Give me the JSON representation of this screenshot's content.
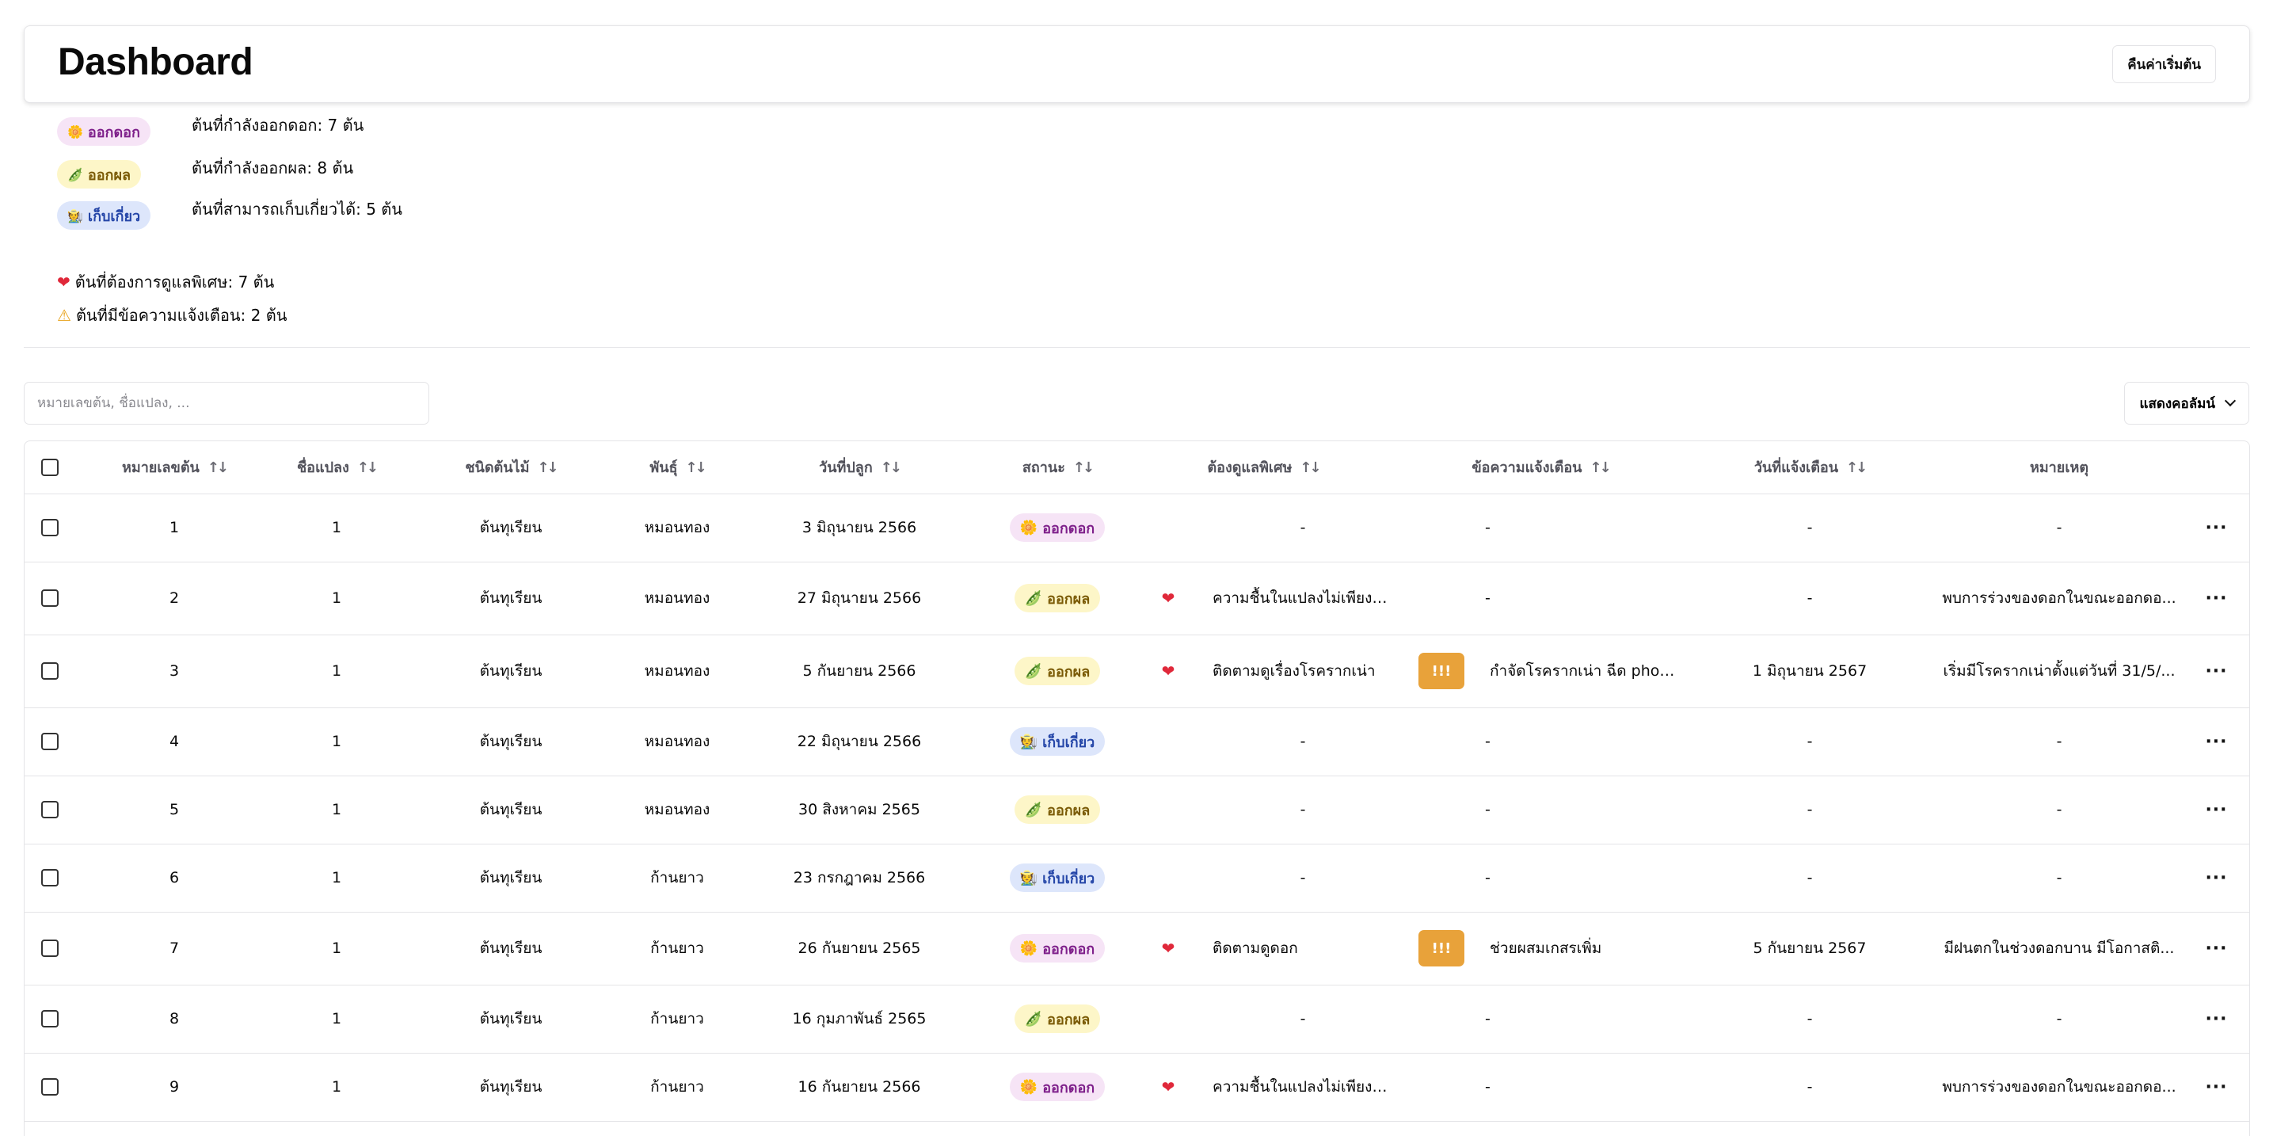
{
  "header": {
    "title": "Dashboard",
    "reset_label": "คืนค่าเริ่มต้น"
  },
  "summary": [
    {
      "badge": "ออกดอก",
      "emoji": "🌼",
      "text": "ต้นที่กำลังออกดอก: 7 ต้น",
      "style": "flower"
    },
    {
      "badge": "ออกผล",
      "emoji": "🫛",
      "text": "ต้นที่กำลังออกผล: 8 ต้น",
      "style": "fruit"
    },
    {
      "badge": "เก็บเกี่ยว",
      "emoji": "🧑‍🌾",
      "text": "ต้นที่สามารถเก็บเกี่ยวได้: 5 ต้น",
      "style": "harvest"
    }
  ],
  "counts": {
    "special_care": "ต้นที่ต้องการดูแลพิเศษ: 7 ต้น",
    "warnings": "ต้นที่มีข้อความแจ้งเตือน: 2 ต้น"
  },
  "search": {
    "placeholder": "หมายเลขต้น, ชื่อแปลง, ..."
  },
  "columns_button": "แสดงคอลัมน์",
  "table": {
    "headers": [
      "หมายเลขต้น",
      "ชื่อแปลง",
      "ชนิดต้นไม้",
      "พันธุ์",
      "วันที่ปลูก",
      "สถานะ",
      "ต้องดูแลพิเศษ",
      "ข้อความแจ้งเตือน",
      "วันที่แจ้งเตือน",
      "หมายเหตุ"
    ],
    "rows": [
      {
        "id": "1",
        "plot": "1",
        "type": "ต้นทุเรียน",
        "variety": "หมอนทอง",
        "planted": "3 มิถุนายน 2566",
        "status": "ออกดอก",
        "status_emoji": "🌼",
        "status_style": "flower",
        "care": "-",
        "care_flag": false,
        "alert": "-",
        "alert_flag": false,
        "alert_date": "-",
        "note": "-"
      },
      {
        "id": "2",
        "plot": "1",
        "type": "ต้นทุเรียน",
        "variety": "หมอนทอง",
        "planted": "27 มิถุนายน 2566",
        "status": "ออกผล",
        "status_emoji": "🫛",
        "status_style": "fruit",
        "care": "ความชื้นในแปลงไม่เพียงพ...",
        "care_flag": true,
        "alert": "-",
        "alert_flag": false,
        "alert_date": "-",
        "note": "พบการร่วงของดอกในขณะออกดอ..."
      },
      {
        "id": "3",
        "plot": "1",
        "type": "ต้นทุเรียน",
        "variety": "หมอนทอง",
        "planted": "5 กันยายน 2566",
        "status": "ออกผล",
        "status_emoji": "🫛",
        "status_style": "fruit",
        "care": "ติดตามดูเรื่องโรครากเน่า",
        "care_flag": true,
        "alert": "กำจัดโรครากเน่า ฉีด phos...",
        "alert_flag": true,
        "alert_date": "1 มิถุนายน 2567",
        "note": "เริ่มมีโรครากเน่าตั้งแต่วันที่ 31/5/..."
      },
      {
        "id": "4",
        "plot": "1",
        "type": "ต้นทุเรียน",
        "variety": "หมอนทอง",
        "planted": "22 มิถุนายน 2566",
        "status": "เก็บเกี่ยว",
        "status_emoji": "🧑‍🌾",
        "status_style": "harvest",
        "care": "-",
        "care_flag": false,
        "alert": "-",
        "alert_flag": false,
        "alert_date": "-",
        "note": "-"
      },
      {
        "id": "5",
        "plot": "1",
        "type": "ต้นทุเรียน",
        "variety": "หมอนทอง",
        "planted": "30 สิงหาคม 2565",
        "status": "ออกผล",
        "status_emoji": "🫛",
        "status_style": "fruit",
        "care": "-",
        "care_flag": false,
        "alert": "-",
        "alert_flag": false,
        "alert_date": "-",
        "note": "-"
      },
      {
        "id": "6",
        "plot": "1",
        "type": "ต้นทุเรียน",
        "variety": "ก้านยาว",
        "planted": "23 กรกฎาคม 2566",
        "status": "เก็บเกี่ยว",
        "status_emoji": "🧑‍🌾",
        "status_style": "harvest",
        "care": "-",
        "care_flag": false,
        "alert": "-",
        "alert_flag": false,
        "alert_date": "-",
        "note": "-"
      },
      {
        "id": "7",
        "plot": "1",
        "type": "ต้นทุเรียน",
        "variety": "ก้านยาว",
        "planted": "26 กันยายน 2565",
        "status": "ออกดอก",
        "status_emoji": "🌼",
        "status_style": "flower",
        "care": "ติดตามดูดอก",
        "care_flag": true,
        "alert": "ช่วยผสมเกสรเพิ่ม",
        "alert_flag": true,
        "alert_date": "5 กันยายน 2567",
        "note": "มีฝนตกในช่วงดอกบาน มีโอกาสติ..."
      },
      {
        "id": "8",
        "plot": "1",
        "type": "ต้นทุเรียน",
        "variety": "ก้านยาว",
        "planted": "16 กุมภาพันธ์ 2565",
        "status": "ออกผล",
        "status_emoji": "🫛",
        "status_style": "fruit",
        "care": "-",
        "care_flag": false,
        "alert": "-",
        "alert_flag": false,
        "alert_date": "-",
        "note": "-"
      },
      {
        "id": "9",
        "plot": "1",
        "type": "ต้นทุเรียน",
        "variety": "ก้านยาว",
        "planted": "16 กันยายน 2566",
        "status": "ออกดอก",
        "status_emoji": "🌼",
        "status_style": "flower",
        "care": "ความชื้นในแปลงไม่เพียงพ...",
        "care_flag": true,
        "alert": "-",
        "alert_flag": false,
        "alert_date": "-",
        "note": "พบการร่วงของดอกในขณะออกดอ..."
      }
    ],
    "alert_button_label": "!!!",
    "row_menu_label": "···"
  },
  "icons": {
    "sort": "sort-arrows-icon",
    "heart": "heart-icon",
    "warning": "warning-icon",
    "chevron": "chevron-down-icon"
  },
  "colors": {
    "flower_bg": "#f6e4f6",
    "flower_fg": "#7e1f8a",
    "fruit_bg": "#fdf6c8",
    "fruit_fg": "#7a5a05",
    "harvest_bg": "#dde6fb",
    "harvest_fg": "#2546a8",
    "alert": "#e8a23a",
    "heart": "#e0283a"
  }
}
